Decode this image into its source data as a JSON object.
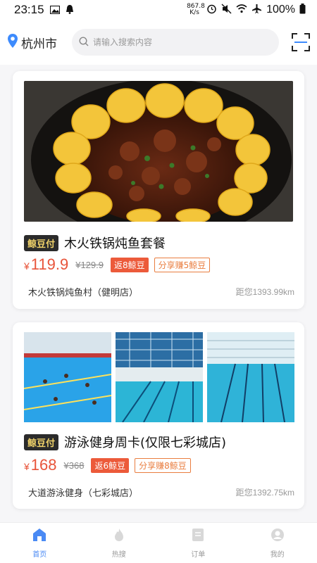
{
  "status_bar": {
    "time": "23:15",
    "net_speed_value": "867.8",
    "net_speed_unit": "K/s",
    "battery": "100%"
  },
  "header": {
    "city": "杭州市",
    "search_placeholder": "请输入搜索内容",
    "accent_color": "#3d8bfd"
  },
  "cards": [
    {
      "badge": "鲸豆付",
      "title": "木火铁锅炖鱼套餐",
      "currency": "¥",
      "price": "119.9",
      "original_price": "¥129.9",
      "rebate": "返8鲸豆",
      "share": "分享赚5鲸豆",
      "shop": "木火铁锅炖鱼村（健明店）",
      "distance": "距您1393.99km"
    },
    {
      "badge": "鲸豆付",
      "title": "游泳健身周卡(仅限七彩城店)",
      "currency": "¥",
      "price": "168",
      "original_price": "¥368",
      "rebate": "返6鲸豆",
      "share": "分享赚8鲸豆",
      "shop": "大道游泳健身（七彩城店）",
      "distance": "距您1392.75km"
    }
  ],
  "tabs": [
    {
      "label": "首页",
      "icon": "home-icon",
      "active": true
    },
    {
      "label": "热搜",
      "icon": "flame-icon",
      "active": false
    },
    {
      "label": "订单",
      "icon": "order-icon",
      "active": false
    },
    {
      "label": "我的",
      "icon": "profile-icon",
      "active": false
    }
  ],
  "colors": {
    "price_red": "#e8543a",
    "share_orange": "#e97d3f",
    "badge_bg": "#2b2b2b",
    "badge_text": "#f1d36a",
    "tab_active": "#4a8af4"
  }
}
